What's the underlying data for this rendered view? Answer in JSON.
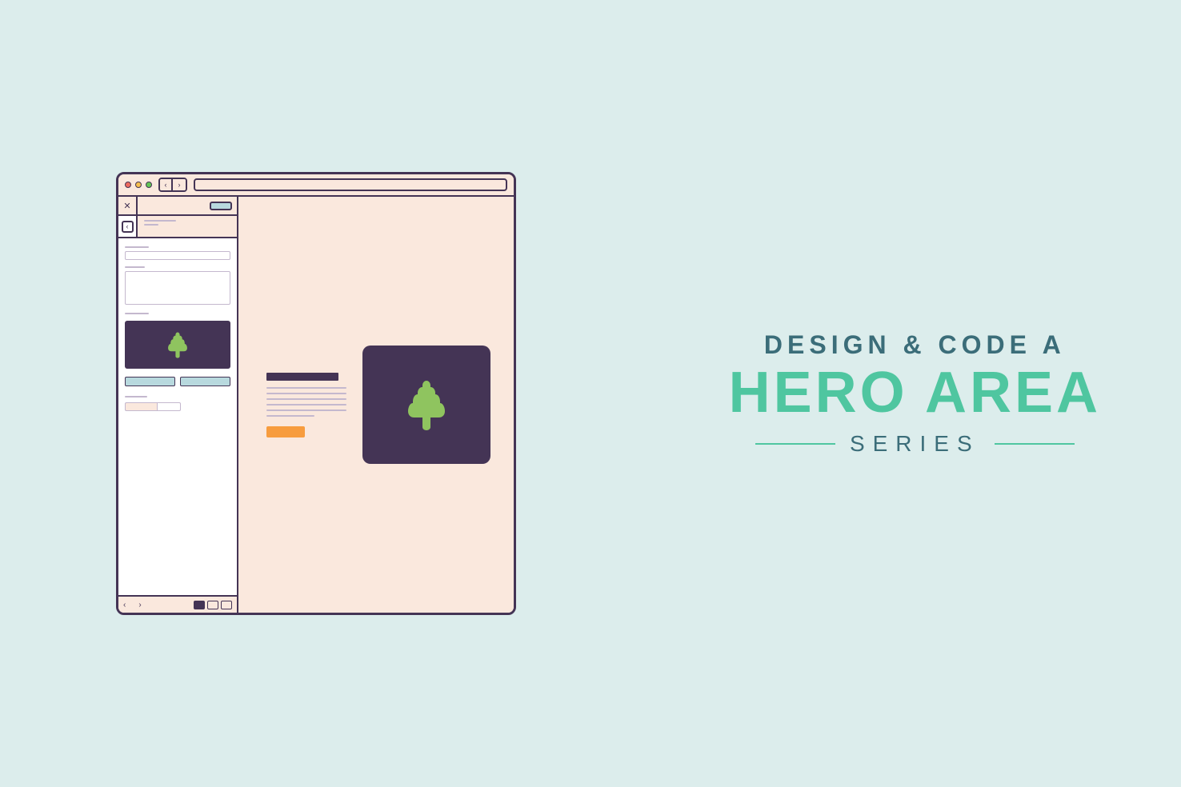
{
  "title": {
    "line1": "DESIGN & CODE A",
    "line2": "HERO AREA",
    "line3": "SERIES"
  },
  "colors": {
    "background": "#dcedec",
    "outline": "#443455",
    "panel": "#fae8dd",
    "accent_teal": "#4fc6a0",
    "accent_dark_teal": "#3b6d79",
    "accent_orange": "#f79c3e",
    "accent_cyan": "#b8d9de",
    "tree_green": "#8fc45f"
  },
  "icons": {
    "tree_large": "tree-icon",
    "tree_small": "tree-icon"
  }
}
